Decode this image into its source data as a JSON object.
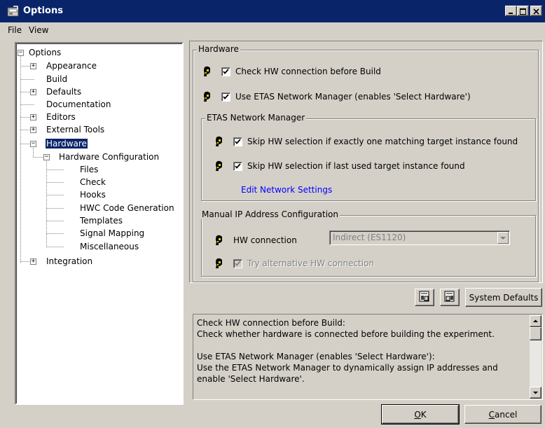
{
  "window": {
    "title": "Options"
  },
  "menu": [
    "File",
    "View"
  ],
  "tree": {
    "root": "Options",
    "items": [
      "Appearance",
      "Build",
      "Defaults",
      "Documentation",
      "Editors",
      "External Tools",
      "Hardware",
      "Hardware Configuration",
      "Files",
      "Check",
      "Hooks",
      "HWC Code Generation",
      "Templates",
      "Signal Mapping",
      "Miscellaneous",
      "Integration"
    ],
    "selected": "Hardware"
  },
  "hardware": {
    "group_title": "Hardware",
    "check_hw": "Check HW connection before Build",
    "use_etas": "Use ETAS Network Manager (enables 'Select Hardware')",
    "check_hw_checked": true,
    "use_etas_checked": true
  },
  "etas": {
    "group_title": "ETAS Network Manager",
    "skip_one": "Skip HW selection if exactly one matching target instance found",
    "skip_last": "Skip HW selection if last used target instance found",
    "skip_one_checked": true,
    "skip_last_checked": true,
    "edit_link": "Edit Network Settings"
  },
  "manual_ip": {
    "group_title": "Manual IP Address Configuration",
    "hw_connection_label": "HW connection",
    "hw_connection_value": "Indirect (ES1120)",
    "try_alt": "Try alternative HW connection",
    "try_alt_checked": true
  },
  "toolbar": {
    "system_defaults": "System Defaults"
  },
  "description": {
    "lines": [
      "Check HW connection before Build:",
      " Check whether hardware is connected before building the experiment.",
      "",
      "Use ETAS Network Manager (enables 'Select Hardware'):",
      " Use the ETAS Network Manager to dynamically assign IP addresses and",
      "enable 'Select Hardware'."
    ]
  },
  "buttons": {
    "ok_underline": "O",
    "ok_rest": "K",
    "cancel_underline": "C",
    "cancel_rest": "ancel"
  },
  "colors": {
    "titlebar": "#0a246a",
    "face": "#d4d0c8",
    "link": "#0000ff"
  }
}
